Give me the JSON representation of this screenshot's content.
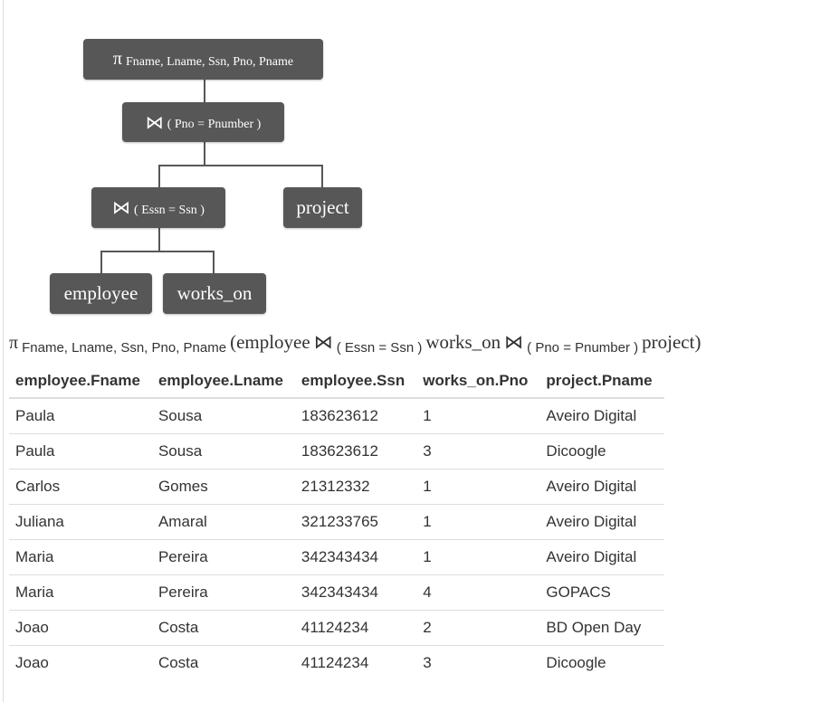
{
  "tree": {
    "projection": {
      "symbol": "π",
      "attributes": "Fname, Lname, Ssn, Pno, Pname"
    },
    "join_top": {
      "symbol": "⋈",
      "condition": "( Pno = Pnumber )"
    },
    "join_bottom": {
      "symbol": "⋈",
      "condition": "( Essn = Ssn )"
    },
    "relations": {
      "project": "project",
      "employee": "employee",
      "works_on": "works_on"
    }
  },
  "expression": {
    "pi": "π",
    "attributes": "Fname, Lname, Ssn, Pno, Pname",
    "open": "(",
    "rel1": "employee",
    "join1_symbol": "⋈",
    "join1_condition": "( Essn = Ssn )",
    "rel2": "works_on",
    "join2_symbol": "⋈",
    "join2_condition": "( Pno = Pnumber )",
    "rel3": "project",
    "close": ")"
  },
  "table": {
    "columns": [
      "employee.Fname",
      "employee.Lname",
      "employee.Ssn",
      "works_on.Pno",
      "project.Pname"
    ],
    "rows": [
      [
        "Paula",
        "Sousa",
        "183623612",
        "1",
        "Aveiro Digital"
      ],
      [
        "Paula",
        "Sousa",
        "183623612",
        "3",
        "Dicoogle"
      ],
      [
        "Carlos",
        "Gomes",
        "21312332",
        "1",
        "Aveiro Digital"
      ],
      [
        "Juliana",
        "Amaral",
        "321233765",
        "1",
        "Aveiro Digital"
      ],
      [
        "Maria",
        "Pereira",
        "342343434",
        "1",
        "Aveiro Digital"
      ],
      [
        "Maria",
        "Pereira",
        "342343434",
        "4",
        "GOPACS"
      ],
      [
        "Joao",
        "Costa",
        "41124234",
        "2",
        "BD Open Day"
      ],
      [
        "Joao",
        "Costa",
        "41124234",
        "3",
        "Dicoogle"
      ]
    ]
  }
}
